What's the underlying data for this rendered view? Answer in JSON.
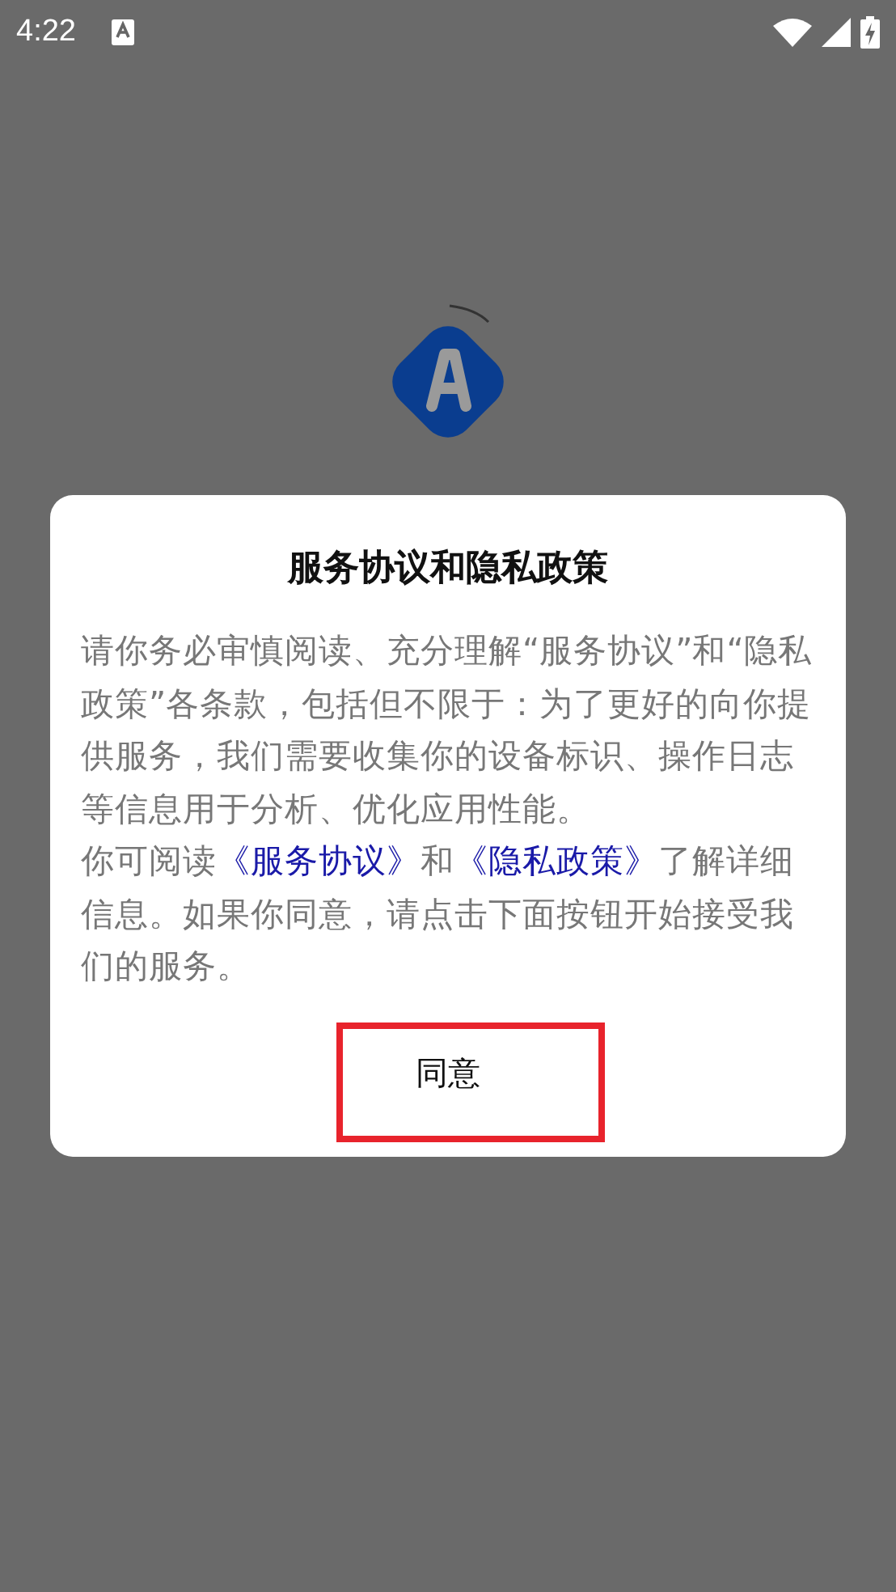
{
  "status_bar": {
    "time": "4:22"
  },
  "dialog": {
    "title": "服务协议和隐私政策",
    "body": [
      {
        "kind": "text",
        "text": "请你务必审慎阅读、充分理解“服务协议”和“隐私政策”各条款，包括但不限于：为了更好的向你提供服务，我们需要收集你的设备标识、操作日志等信息用于分析、优化应用性能。"
      },
      {
        "kind": "break"
      },
      {
        "kind": "text",
        "text": "你可阅读"
      },
      {
        "kind": "link",
        "text": "《服务协议》"
      },
      {
        "kind": "text",
        "text": "和"
      },
      {
        "kind": "link",
        "text": "《隐私政策》"
      },
      {
        "kind": "text",
        "text": "了解详细信息。如果你同意，请点击下面按钮开始接受我们的服务。"
      }
    ],
    "button": "同意"
  }
}
